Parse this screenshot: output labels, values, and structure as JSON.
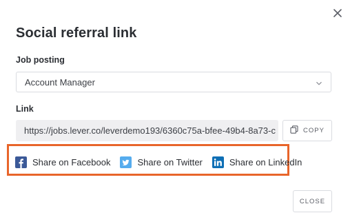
{
  "modal": {
    "title": "Social referral link",
    "close_icon": "close-icon"
  },
  "job_posting": {
    "label": "Job posting",
    "selected": "Account Manager",
    "dropdown_icon": "chevron-down-icon"
  },
  "link": {
    "label": "Link",
    "value": "https://jobs.lever.co/leverdemo193/6360c75a-bfee-49b4-8a73-c",
    "copy_label": "COPY",
    "copy_icon": "copy-icon"
  },
  "share": {
    "highlight_color": "#e8652a",
    "facebook": {
      "label": "Share on Facebook",
      "icon": "facebook-icon",
      "color": "#3b5998"
    },
    "twitter": {
      "label": "Share on Twitter",
      "icon": "twitter-icon",
      "color": "#55acee"
    },
    "linkedin": {
      "label": "Share on LinkedIn",
      "icon": "linkedin-icon",
      "color": "#0e6fb5"
    }
  },
  "footer": {
    "close_label": "CLOSE"
  }
}
